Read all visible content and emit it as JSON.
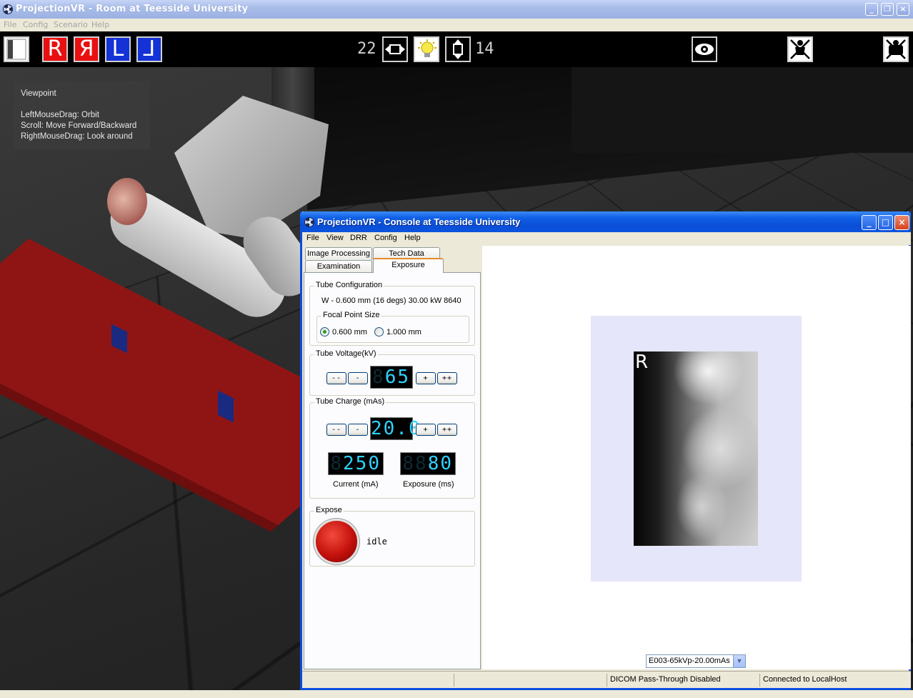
{
  "main_window": {
    "title": "ProjectionVR - Room  at Teesside University",
    "menu": [
      "File",
      "Config",
      "Scenario",
      "Help"
    ],
    "controls": {
      "minimize": "_",
      "restore": "❐",
      "close": "×"
    }
  },
  "toolbar": {
    "marker_buttons": [
      "R",
      "Я",
      "L",
      "⅃"
    ],
    "width_value": "22",
    "height_value": "14",
    "icons": {
      "panel": "panel-icon",
      "horizontal_collimation": "horizontal-arrows-icon",
      "light": "lightbulb-icon",
      "vertical_collimation": "vertical-arrows-icon",
      "eye": "eye-icon",
      "patient": "patient-icon",
      "radiation": "radiation-icon"
    }
  },
  "viewpoint_help": {
    "title": "Viewpoint",
    "lines": [
      "LeftMouseDrag: Orbit",
      "Scroll: Move Forward/Backward",
      "RightMouseDrag: Look around"
    ]
  },
  "console": {
    "title": "ProjectionVR - Console  at Teesside University",
    "menu": [
      "File",
      "View",
      "DRR",
      "Config",
      "Help"
    ],
    "controls": {
      "minimize": "_",
      "maximize": "□",
      "close": "×"
    },
    "tabs_back": [
      "Image Processing",
      "Tech Data"
    ],
    "tabs_front": [
      "Examination",
      "Exposure"
    ],
    "active_tab": "Exposure",
    "tube_config": {
      "label": "Tube Configuration",
      "info": "W -  0.600 mm (16 degs)  30.00 kW 8640",
      "focal_label": "Focal Point Size",
      "focal_options": [
        "0.600 mm",
        "1.000 mm"
      ],
      "focal_selected": 0
    },
    "tube_voltage": {
      "label": "Tube Voltage(kV)",
      "btn_dec2": "--",
      "btn_dec": "-",
      "btn_inc": "+",
      "btn_inc2": "++",
      "ghost": "8",
      "value": "65"
    },
    "tube_charge": {
      "label": "Tube Charge (mAs)",
      "btn_dec2": "--",
      "btn_dec": "-",
      "btn_inc": "+",
      "btn_inc2": "++",
      "value": "20.0",
      "current_ghost": "8",
      "current_value": "250",
      "current_label": "Current (mA)",
      "exposure_ghost": "88",
      "exposure_value": "80",
      "exposure_label": "Exposure (ms)"
    },
    "expose": {
      "label": "Expose",
      "state": "idle"
    },
    "image": {
      "marker": "R",
      "selected": "E003-65kVp-20.00mAs",
      "dropdown_arrow": "▼"
    },
    "status": {
      "dicom": "DICOM Pass-Through Disabled",
      "connection": "Connected to LocalHost"
    }
  }
}
